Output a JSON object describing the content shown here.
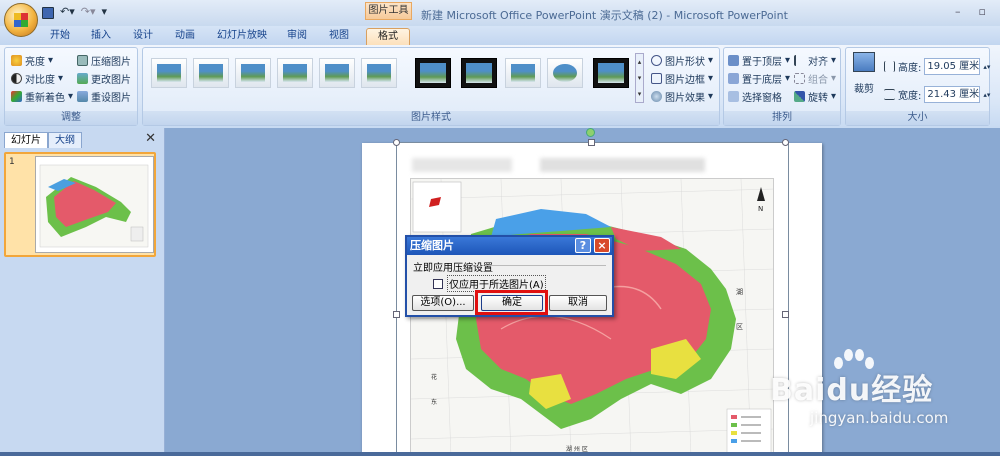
{
  "window": {
    "title": "新建 Microsoft Office PowerPoint 演示文稿 (2) - Microsoft PowerPoint",
    "context_tab_group": "图片工具",
    "minimize_icon": "minus-icon",
    "restore_icon": "restore-icon",
    "qat_icons": [
      "save-icon",
      "undo-icon",
      "redo-icon",
      "customize-icon"
    ]
  },
  "tabs": [
    "开始",
    "插入",
    "设计",
    "动画",
    "幻灯片放映",
    "审阅",
    "视图",
    "格式"
  ],
  "active_tab": "格式",
  "ribbon": {
    "adjust": {
      "label": "调整",
      "brightness": "亮度",
      "contrast": "对比度",
      "recolor": "重新着色",
      "compress": "压缩图片",
      "change": "更改图片",
      "reset": "重设图片"
    },
    "styles": {
      "label": "图片样式",
      "shape": "图片形状",
      "border": "图片边框",
      "effects": "图片效果"
    },
    "arrange": {
      "label": "排列",
      "front": "置于顶层",
      "back": "置于底层",
      "selection": "选择窗格",
      "align": "对齐",
      "group": "组合",
      "rotate": "旋转"
    },
    "size": {
      "label": "大小",
      "crop": "裁剪",
      "height_label": "高度:",
      "height_value": "19.05 厘米",
      "width_label": "宽度:",
      "width_value": "21.43 厘米"
    }
  },
  "left_pane": {
    "tabs": [
      "幻灯片",
      "大纲"
    ],
    "slide_number": "1"
  },
  "dialog": {
    "title": "压缩图片",
    "help": "?",
    "close": "×",
    "section": "立即应用压缩设置",
    "checkbox_label": "仅应用于所选图片(A)",
    "checkbox_checked": false,
    "options_button": "选项(O)...",
    "ok_button": "确定",
    "cancel_button": "取消"
  },
  "map": {
    "label_north": "N",
    "labels": [
      "湖",
      "区",
      "湖 州 区",
      "花",
      "东"
    ]
  },
  "watermark": {
    "brand": "Baidu经验",
    "url": "jingyan.baidu.com"
  },
  "colors": {
    "highlight": "#e01010",
    "dialog_title": "#1d55b8",
    "active_tab": "#fce0bb",
    "map_red": "#e45a6a",
    "map_green": "#6cc04a",
    "map_yellow": "#e8e040"
  }
}
